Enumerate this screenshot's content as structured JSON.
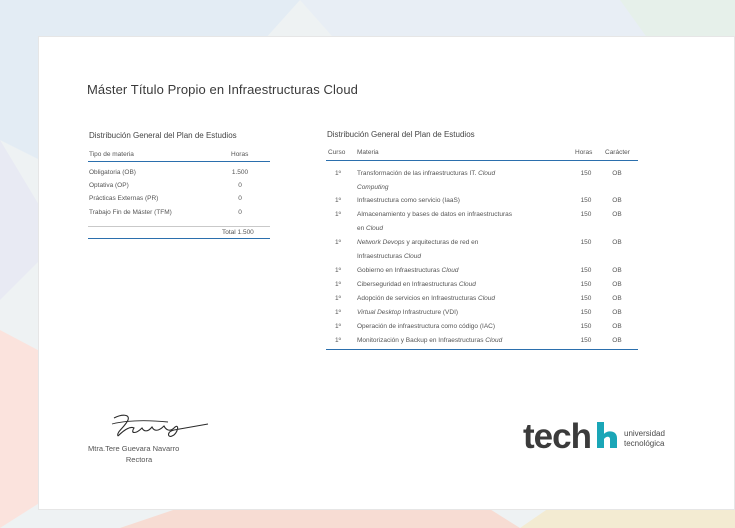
{
  "title": "Máster Título Propio en Infraestructuras Cloud",
  "left_table": {
    "heading": "Distribución General del Plan de Estudios",
    "col_type": "Tipo de materia",
    "col_hours": "Horas",
    "rows": [
      {
        "type": "Obligatoria (OB)",
        "hours": "1.500"
      },
      {
        "type": "Optativa (OP)",
        "hours": "0"
      },
      {
        "type": "Prácticas Externas (PR)",
        "hours": "0"
      },
      {
        "type": "Trabajo Fin de Máster (TFM)",
        "hours": "0"
      }
    ],
    "total": "Total 1.500"
  },
  "right_table": {
    "heading": "Distribución General del Plan de Estudios",
    "col_course": "Curso",
    "col_subject": "Materia",
    "col_hours": "Horas",
    "col_type": "Carácter",
    "rows": [
      {
        "course": "1º",
        "subject_line1": "Transformación de las infraestructuras IT. ",
        "subject_line1_em": "Cloud",
        "subject_line2": "",
        "subject_line2_em": "Computing",
        "hours": "150",
        "type": "OB"
      },
      {
        "course": "1º",
        "subject_line1": "Infraestructura como servicio (IaaS)",
        "hours": "150",
        "type": "OB"
      },
      {
        "course": "1º",
        "subject_line1": "Almacenamiento y bases de datos en infraestructuras",
        "subject_line2": "en ",
        "subject_line2_em": "Cloud",
        "hours": "150",
        "type": "OB"
      },
      {
        "course": "1º",
        "subject_line1_em_first": "Network Devops",
        "subject_line1": " y arquitecturas de red en",
        "subject_line2": "Infraestructuras ",
        "subject_line2_em": "Cloud",
        "hours": "150",
        "type": "OB"
      },
      {
        "course": "1º",
        "subject_line1": "Gobierno en Infraestructuras ",
        "subject_line1_em": "Cloud",
        "hours": "150",
        "type": "OB"
      },
      {
        "course": "1º",
        "subject_line1": "Ciberseguridad en Infraestructuras ",
        "subject_line1_em": "Cloud",
        "hours": "150",
        "type": "OB"
      },
      {
        "course": "1º",
        "subject_line1": "Adopción de servicios en Infraestructuras ",
        "subject_line1_em": "Cloud",
        "hours": "150",
        "type": "OB"
      },
      {
        "course": "1º",
        "subject_line1_em_first": "Virtual Desktop",
        "subject_line1": " Infrastructure (VDI)",
        "hours": "150",
        "type": "OB"
      },
      {
        "course": "1º",
        "subject_line1": "Operación de infraestructura como código (IAC)",
        "hours": "150",
        "type": "OB"
      },
      {
        "course": "1º",
        "subject_line1": "Monitorización y Backup en Infraestructuras ",
        "subject_line1_em": "Cloud",
        "hours": "150",
        "type": "OB"
      }
    ]
  },
  "signature": {
    "name": "Mtra.Tere Guevara Navarro",
    "role": "Rectora"
  },
  "logo": {
    "word": "tech",
    "line1": "universidad",
    "line2": "tecnológica"
  },
  "colors": {
    "accent": "#2b6fad",
    "logo_teal": "#1aa6b7"
  }
}
